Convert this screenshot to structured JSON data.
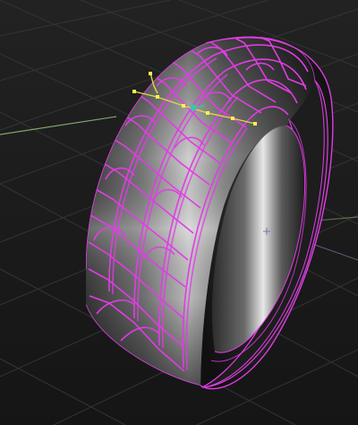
{
  "viewport": {
    "background_color": "#1c1c1c",
    "grid_color": "#3a3a3a",
    "axis_x_color": "#7ea86a",
    "axis_y_color": "#6b7bb0"
  },
  "model": {
    "name": "tire",
    "tread_surface_color": "#8a8a8a",
    "sidewall_color": "#2b2b2b",
    "rim_color": "#d4d4d4",
    "wire_edge_color": "#e23ce6",
    "selected_edge_color": "#e0d64a",
    "selected_vertex_color": "#fff24a",
    "gizmo_color": "#38c7a6"
  }
}
